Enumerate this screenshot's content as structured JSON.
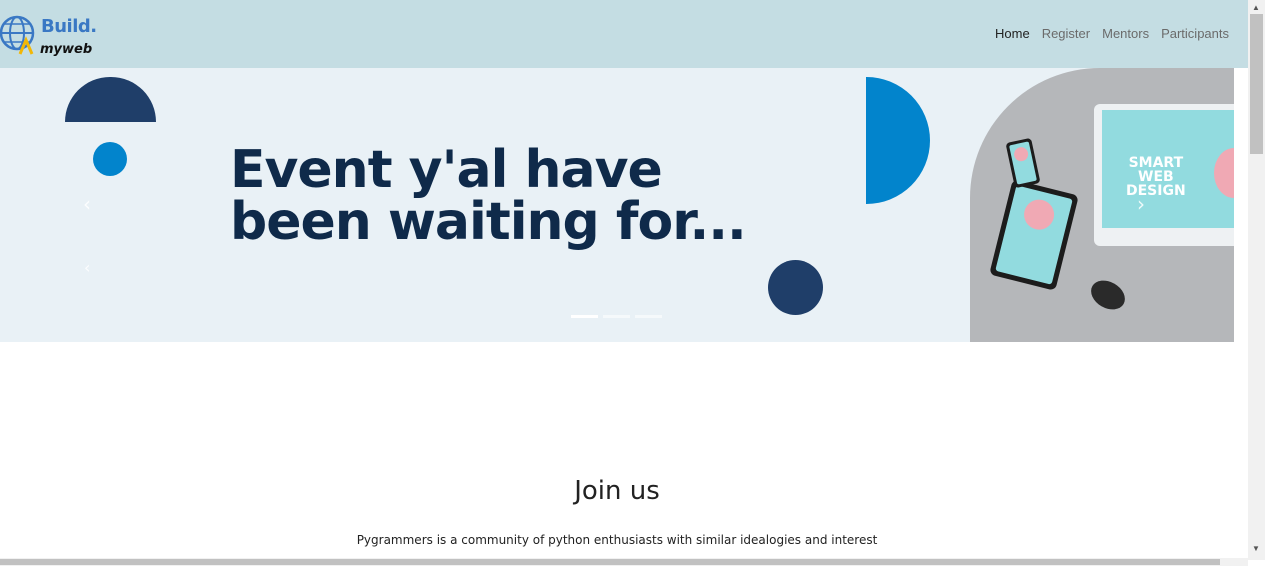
{
  "brand": {
    "line1": "Build.",
    "line2": "myweb"
  },
  "nav": {
    "home": "Home",
    "register": "Register",
    "mentors": "Mentors",
    "participants": "Participants"
  },
  "hero": {
    "headline": "Event y'al have\nbeen waiting for...",
    "screen_text": "SMART\nWEB\nDESIGN",
    "prev_icon": "chevron-left-icon",
    "next_icon": "chevron-right-icon",
    "slide_count": 3,
    "active_slide": 1
  },
  "join": {
    "title": "Join us",
    "text": "Pygrammers is a community of python enthusiasts with similar idealogies and interest"
  },
  "colors": {
    "navbar": "#c4dde3",
    "hero_bg": "#e9f1f6",
    "navy": "#1f3e69",
    "blue": "#0284cc"
  }
}
